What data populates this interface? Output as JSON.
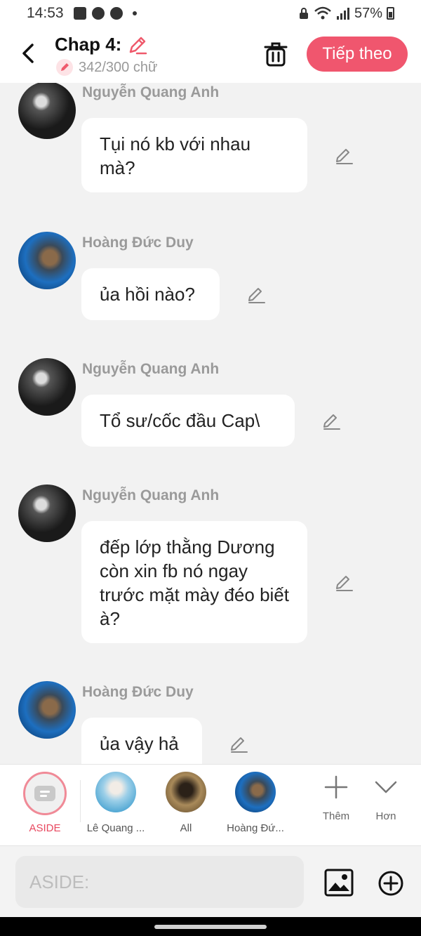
{
  "status_bar": {
    "time": "14:53",
    "battery": "57%"
  },
  "header": {
    "title": "Chap 4:",
    "word_count": "342/300 chữ",
    "next_label": "Tiếp theo"
  },
  "messages": [
    {
      "sender": "Nguyễn Quang Anh",
      "text": "Tụi nó kb với nhau mà?"
    },
    {
      "sender": "Hoàng Đức Duy",
      "text": "ủa hồi nào?"
    },
    {
      "sender": "Nguyễn Quang Anh",
      "text": "Tổ sư/cốc đầu Cap\\"
    },
    {
      "sender": "Nguyễn Quang Anh",
      "text": "đếp lớp thằng Dương còn xin fb nó ngay trước mặt mày đéo biết à?"
    },
    {
      "sender": "Hoàng Đức Duy",
      "text": "ủa vậy hả"
    }
  ],
  "characters": [
    {
      "label": "ASIDE"
    },
    {
      "label": "Lê Quang ..."
    },
    {
      "label": "All"
    },
    {
      "label": "Hoàng Đứ..."
    }
  ],
  "tools": {
    "add_label": "Thêm",
    "more_label": "Hơn"
  },
  "input": {
    "placeholder": "ASIDE:"
  },
  "colors": {
    "accent": "#f0566e",
    "accent_text": "#e8485f",
    "bubble": "#ffffff",
    "background": "#f2f2f2"
  }
}
